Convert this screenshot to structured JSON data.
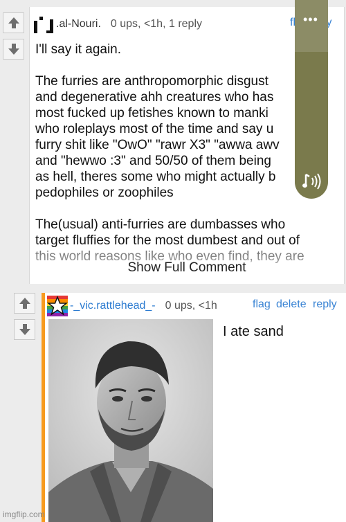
{
  "comment1": {
    "username": ".al-Nouri.",
    "meta": "0 ups, <1h, 1 reply",
    "flag_label": "fl",
    "reply_label": "ply",
    "body": "I'll say it again.\n\nThe furries are anthropomorphic disgust\nand degenerative ahh creatures who has\nmost fucked up fetishes known to manki\nwho roleplays most of the time and say u\nfurry shit like \"OwO\" \"rawr X3\" \"awwa awv\nand \"hewwo :3\" and 50/50 of them being\nas hell, theres some who might actually b\npedophiles or zoophiles\n\nThe(usual) anti-furries are dumbasses who\ntarget fluffies for the most dumbest and out of\nthis world reasons like who even find, they are",
    "show_full": "Show Full Comment"
  },
  "comment2": {
    "username": "-_vic.rattlehead_-",
    "meta": "0 ups, <1h",
    "flag_label": "flag",
    "delete_label": "delete",
    "reply_label": "reply",
    "body": "I ate sand"
  },
  "volume_panel": {
    "menu_icon": "more-dots-icon",
    "sound_icon": "music-note-icon",
    "level": 0.74,
    "dots": "•••"
  },
  "watermark": "imgflip.com",
  "colors": {
    "link": "#3a84d4",
    "username2": "#2a7ad0",
    "stripe": "#f79a1e",
    "volume": "#7a7a4c"
  }
}
